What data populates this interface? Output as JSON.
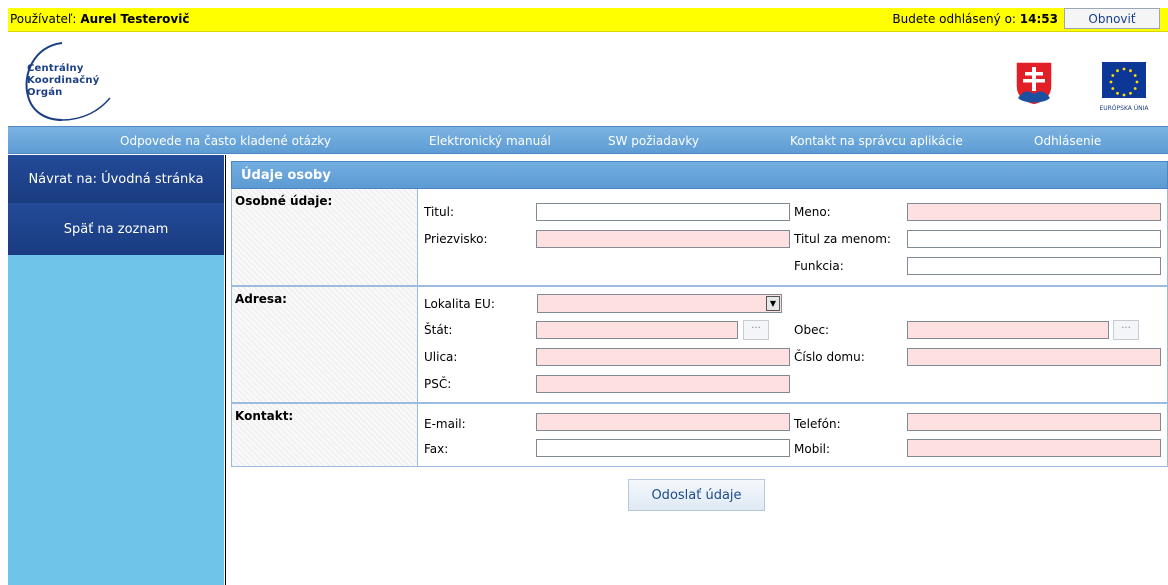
{
  "topbar": {
    "user_label": "Používateľ:",
    "user_name": "Aurel Testerovič",
    "logout_label": "Budete odhlásený o:",
    "logout_time": "14:53",
    "refresh_button": "Obnoviť"
  },
  "header": {
    "logo_text": "Centrálny\nKoordinačný\nOrgán",
    "eu_caption": "EURÓPSKA ÚNIA"
  },
  "nav": {
    "items": [
      "Odpovede na často kladené otázky",
      "Elektronický manuál",
      "SW požiadavky",
      "Kontakt na správcu aplikácie",
      "Odhlásenie"
    ]
  },
  "sidebar": {
    "items": [
      "Návrat na: Úvodná stránka",
      "Späť na zoznam"
    ]
  },
  "panel": {
    "title": "Údaje osoby"
  },
  "form": {
    "sections": {
      "personal": "Osobné údaje:",
      "address": "Adresa:",
      "contact": "Kontakt:"
    },
    "labels": {
      "title": "Titul:",
      "first_name": "Meno:",
      "surname": "Priezvisko:",
      "title_after": "Titul za menom:",
      "function": "Funkcia:",
      "eu_locality": "Lokalita EU:",
      "state": "Štát:",
      "municipality": "Obec:",
      "street": "Ulica:",
      "house_number": "Číslo domu:",
      "zip": "PSČ:",
      "email": "E-mail:",
      "phone": "Telefón:",
      "fax": "Fax:",
      "mobile": "Mobil:"
    },
    "lookup_button": "···",
    "submit": "Odoslať údaje"
  },
  "colors": {
    "topbar": "#ffff00",
    "nav": "#6aa8dc",
    "sidebar": "#6fc4ea",
    "sidebar_item": "#1f4590",
    "required_field": "#ffe0e0"
  }
}
